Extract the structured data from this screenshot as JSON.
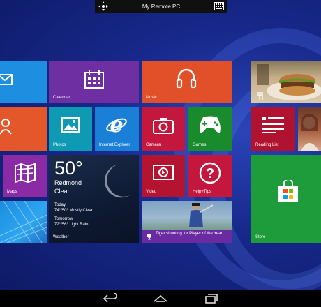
{
  "remote_bar": {
    "title": "My Remote PC",
    "move_icon": "move-arrows-icon",
    "keyboard_icon": "keyboard-icon"
  },
  "tiles": {
    "mail": {
      "icon": "mail-icon",
      "color": "#1e8fe0"
    },
    "people": {
      "icon": "people-icon",
      "color": "#e3572a"
    },
    "calendar": {
      "label": "Calendar",
      "icon": "calendar-icon",
      "color": "#6e2fa3"
    },
    "music": {
      "label": "Music",
      "icon": "headphones-icon",
      "color": "#e2502a"
    },
    "photos": {
      "label": "Photos",
      "icon": "photos-icon",
      "color": "#0f9ab3"
    },
    "ie": {
      "label": "Internet Explorer",
      "icon": "internet-explorer-icon",
      "color": "#1a7fd6"
    },
    "camera": {
      "label": "Camera",
      "icon": "camera-icon",
      "color": "#c4173e"
    },
    "games": {
      "label": "Games",
      "icon": "game-controller-icon",
      "color": "#1a8b2d"
    },
    "maps": {
      "label": "Maps",
      "icon": "maps-icon",
      "color": "#8a2aa5"
    },
    "weather": {
      "label": "Weather",
      "temp": "50°",
      "city": "Redmond",
      "condition": "Clear",
      "today_label": "Today",
      "today_forecast": "74°/50° Mostly Clear",
      "tomorrow_label": "Tomorrow",
      "tomorrow_forecast": "72°/56° Light Rain"
    },
    "video": {
      "label": "Video",
      "icon": "video-play-icon",
      "color": "#b51430"
    },
    "help": {
      "label": "Help+Tips",
      "icon": "help-question-icon",
      "color": "#c4173e"
    },
    "news": {
      "caption": "Tiger shooting for Player of the Year",
      "icon": "trophy-icon",
      "color": "#6a2aa0"
    },
    "food": {
      "icon": "food-icon"
    },
    "reading_list": {
      "label": "Reading List",
      "icon": "reading-list-icon",
      "color": "#b01330"
    },
    "store": {
      "label": "Store",
      "icon": "store-bag-icon",
      "color": "#1e9b3a"
    }
  },
  "navbar": {
    "back_icon": "back-arrow-icon",
    "home_icon": "home-icon",
    "recents_icon": "recent-apps-icon"
  }
}
